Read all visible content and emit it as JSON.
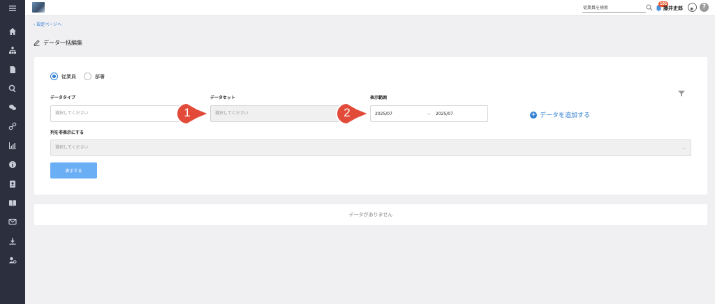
{
  "header": {
    "search_placeholder": "従業員を検索",
    "notification_count": "101",
    "user_name": "藤井史郎",
    "help_label": "?"
  },
  "page": {
    "back_link": "設定ページへ",
    "title": "データ一括編集"
  },
  "form": {
    "radios": [
      {
        "label": "従業員",
        "selected": true
      },
      {
        "label": "部署",
        "selected": false
      }
    ],
    "data_type": {
      "label": "データタイプ",
      "placeholder": "選択してください"
    },
    "dataset": {
      "label": "データセット",
      "placeholder": "選択してください"
    },
    "range": {
      "label": "表示範囲",
      "from": "2025/07",
      "to": "2025/07",
      "arrow": "→"
    },
    "add_data": "データを追加する",
    "hide_columns": {
      "label": "列を非表示にする",
      "placeholder": "選択してください"
    },
    "show_button": "表示する"
  },
  "results": {
    "empty_message": "データがありません"
  },
  "callouts": [
    "1",
    "2"
  ],
  "colors": {
    "sidebar": "#2b2f3e",
    "accent": "#2d7dd2",
    "button": "#6aaef5",
    "callout": "#e24b3a",
    "badge": "#e8542e"
  },
  "sidebar_icons": [
    "menu-icon",
    "home-icon",
    "org-chart-icon",
    "document-icon",
    "search-icon",
    "chat-icon",
    "link-icon",
    "chart-icon",
    "info-icon",
    "contact-icon",
    "book-icon",
    "mail-icon",
    "download-icon",
    "user-settings-icon"
  ]
}
